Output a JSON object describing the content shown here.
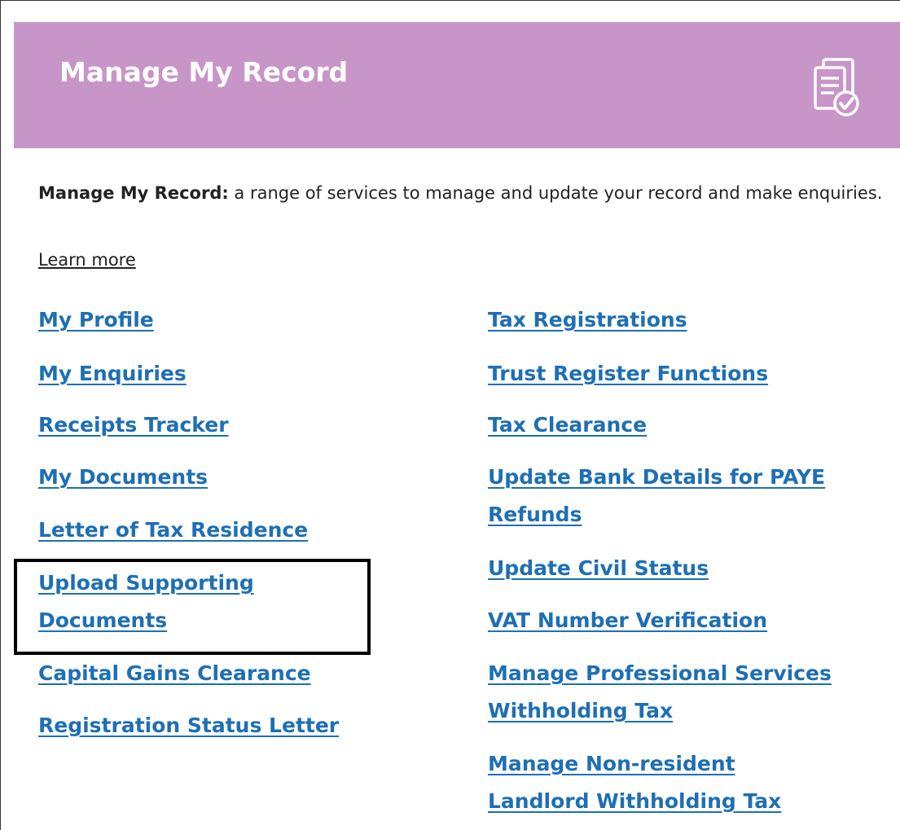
{
  "header": {
    "title": "Manage My Record",
    "background_color": "#c795c8",
    "icon": "document-checklist-icon"
  },
  "intro": {
    "bold_text": "Manage My Record:",
    "text": " a range of services to manage and update your record and make enquiries."
  },
  "learn_more": "Learn more",
  "link_color": "#1e6fb5",
  "left_links": [
    {
      "line1": "My Profile"
    },
    {
      "line1": "My Enquiries"
    },
    {
      "line1": "Receipts Tracker"
    },
    {
      "line1": "My Documents"
    },
    {
      "line1": "Letter of Tax Residence"
    },
    {
      "line1": "Upload Supporting",
      "line2": "Documents"
    },
    {
      "line1": "Capital Gains Clearance"
    },
    {
      "line1": "Registration Status Letter"
    }
  ],
  "right_links": [
    {
      "line1": "Tax Registrations"
    },
    {
      "line1": "Trust Register Functions"
    },
    {
      "line1": "Tax Clearance"
    },
    {
      "line1": "Update Bank Details for PAYE",
      "line2": "Refunds"
    },
    {
      "line1": "Update Civil Status"
    },
    {
      "line1": "VAT Number Verification"
    },
    {
      "line1": "Manage Professional Services",
      "line2": "Withholding Tax"
    },
    {
      "line1": "Manage Non-resident",
      "line2": "Landlord Withholding Tax"
    }
  ]
}
